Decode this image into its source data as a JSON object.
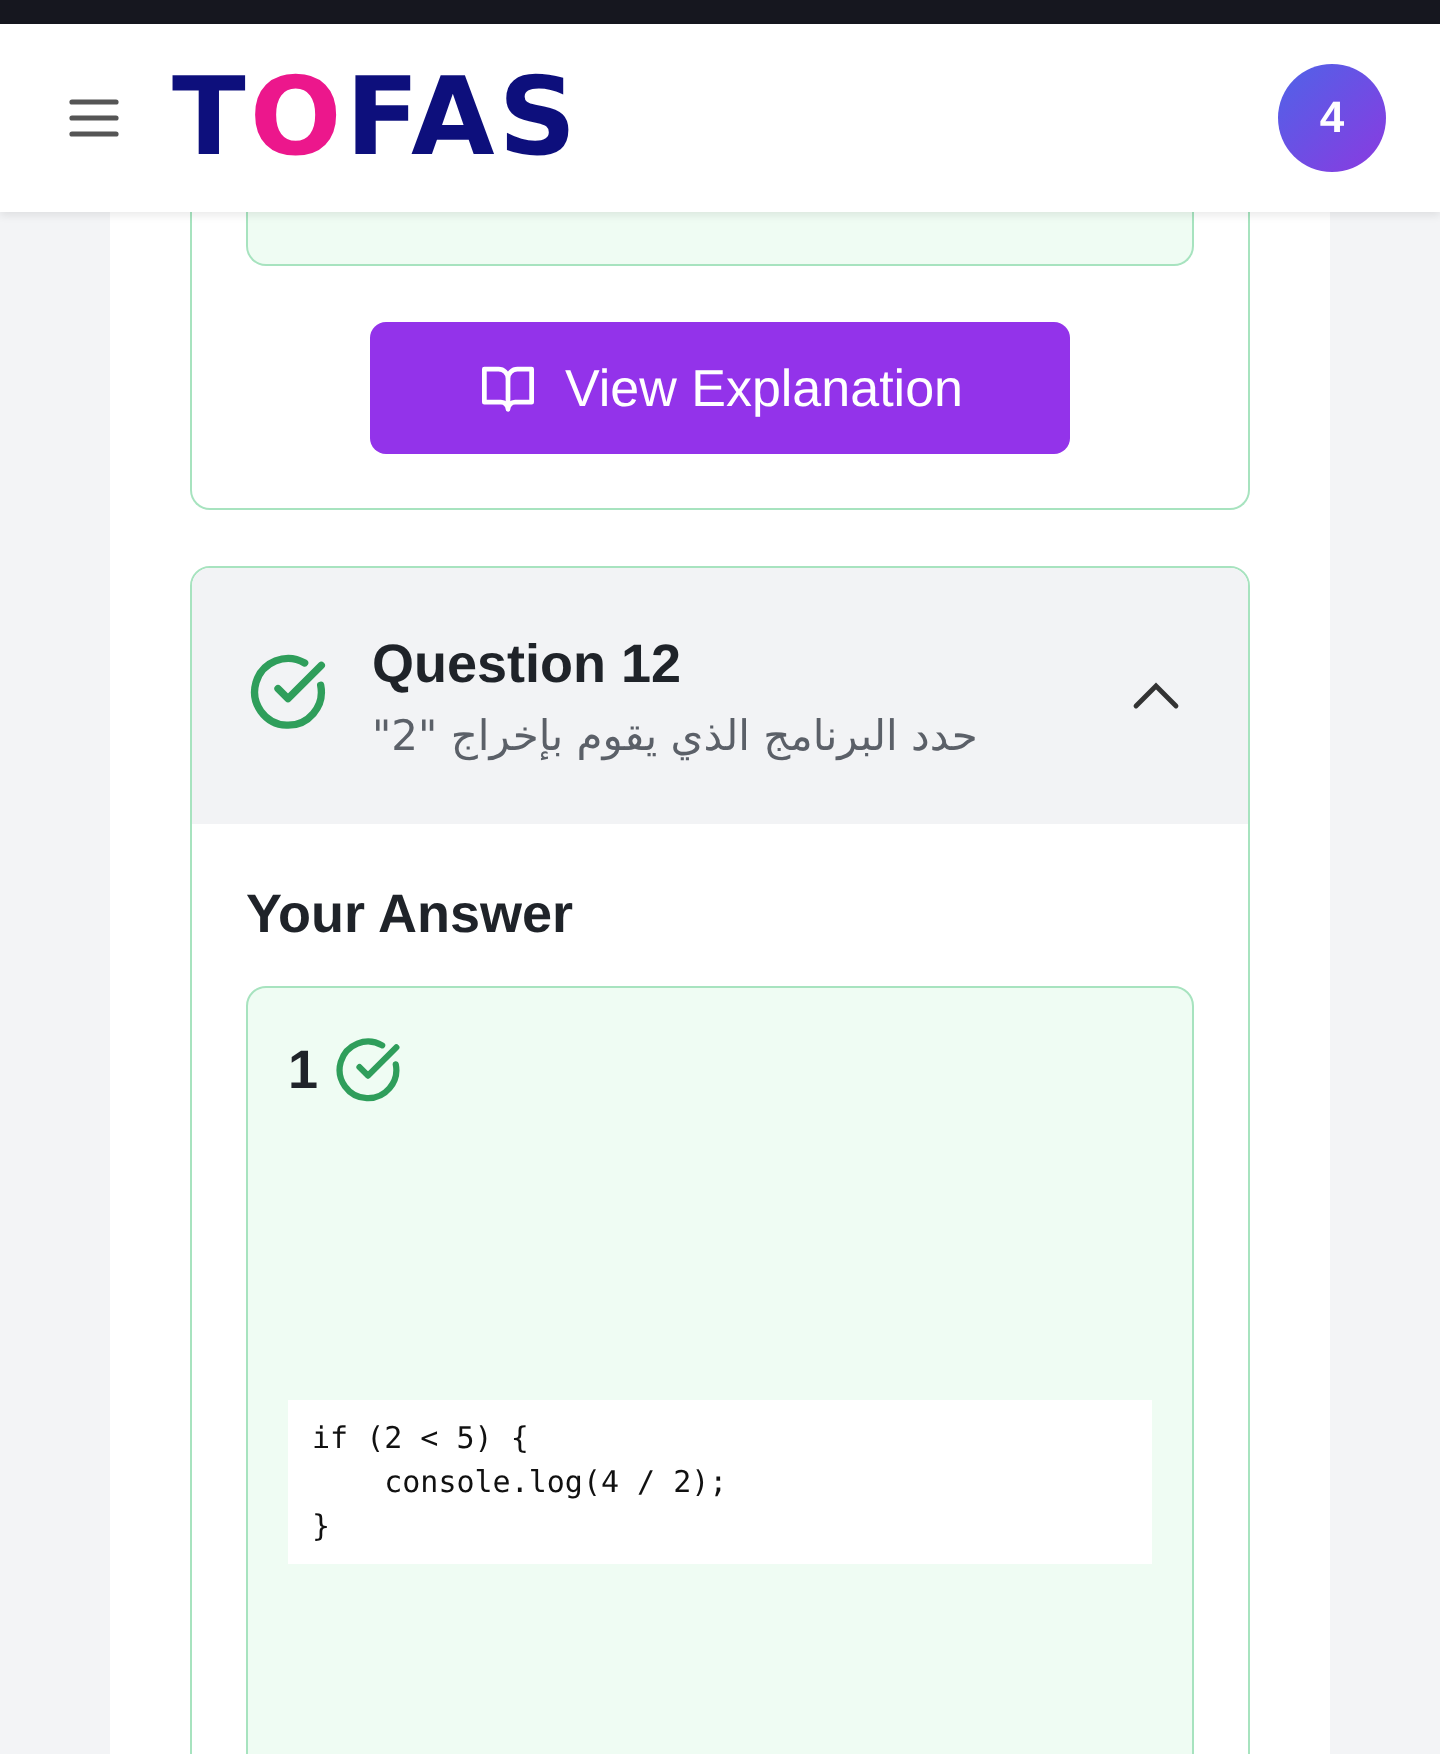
{
  "header": {
    "logo": [
      {
        "text": "T",
        "color": "#0d0f7c"
      },
      {
        "text": "O",
        "color": "#ec178c"
      },
      {
        "text": "FAS",
        "color": "#0d0f7c"
      }
    ],
    "avatar": "4"
  },
  "previous_question": {
    "button": "View Explanation"
  },
  "question": {
    "title": "Question 12",
    "prompt": "حدد البرنامج الذي يقوم بإخراج \"2\"",
    "correct": true,
    "expanded": true,
    "answer_heading": "Your Answer",
    "answers": [
      {
        "number": "1",
        "correct": true,
        "code": "if (2 < 5) {\n    console.log(4 / 2);\n}"
      }
    ]
  }
}
